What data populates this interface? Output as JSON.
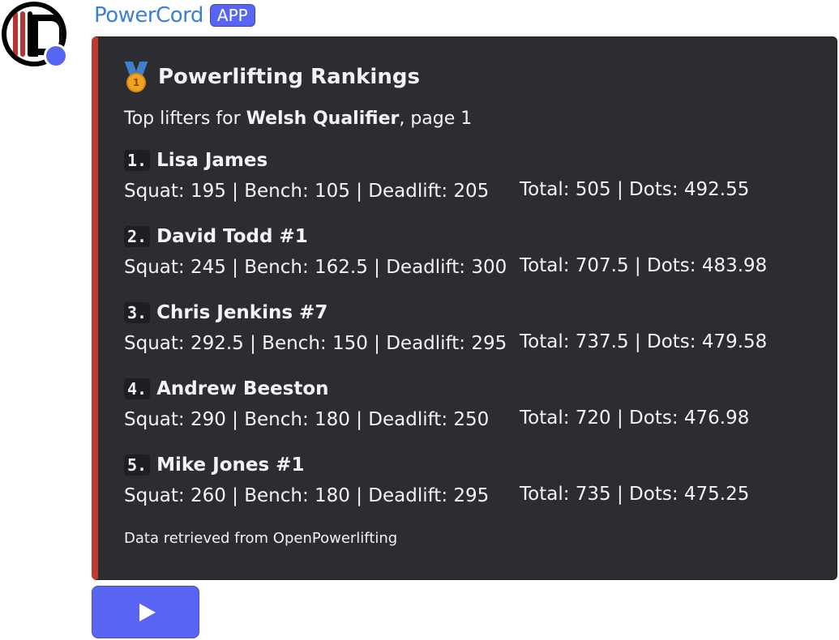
{
  "message": {
    "username": "PowerCord",
    "app_badge": "APP",
    "avatar_icon": "powercord-logo-icon"
  },
  "embed": {
    "accent_color": "#c0392f",
    "title_icon": "gold-medal-icon",
    "title": "Powerlifting Rankings",
    "subtitle_prefix": "Top lifters for ",
    "subtitle_meet": "Welsh Qualifier",
    "subtitle_suffix": ", page 1",
    "entries": [
      {
        "rank": "1.",
        "name": "Lisa James",
        "stats": "Squat: 195 | Bench: 105 | Deadlift: 205",
        "totals": "Total: 505 | Dots: 492.55"
      },
      {
        "rank": "2.",
        "name": "David Todd #1",
        "stats": "Squat: 245 | Bench: 162.5 | Deadlift: 300",
        "totals": "Total: 707.5 | Dots: 483.98"
      },
      {
        "rank": "3.",
        "name": "Chris Jenkins #7",
        "stats": "Squat: 292.5 | Bench: 150 | Deadlift: 295",
        "totals": "Total: 737.5 | Dots: 479.58"
      },
      {
        "rank": "4.",
        "name": "Andrew Beeston",
        "stats": "Squat: 290 | Bench: 180 | Deadlift: 250",
        "totals": "Total: 720 | Dots: 476.98"
      },
      {
        "rank": "5.",
        "name": "Mike Jones #1",
        "stats": "Squat: 260 | Bench: 180 | Deadlift: 295",
        "totals": "Total: 735 | Dots: 475.25"
      }
    ],
    "footer": "Data retrieved from OpenPowerlifting"
  },
  "actions": {
    "play_icon": "play-icon",
    "button_color": "#5865f2"
  }
}
